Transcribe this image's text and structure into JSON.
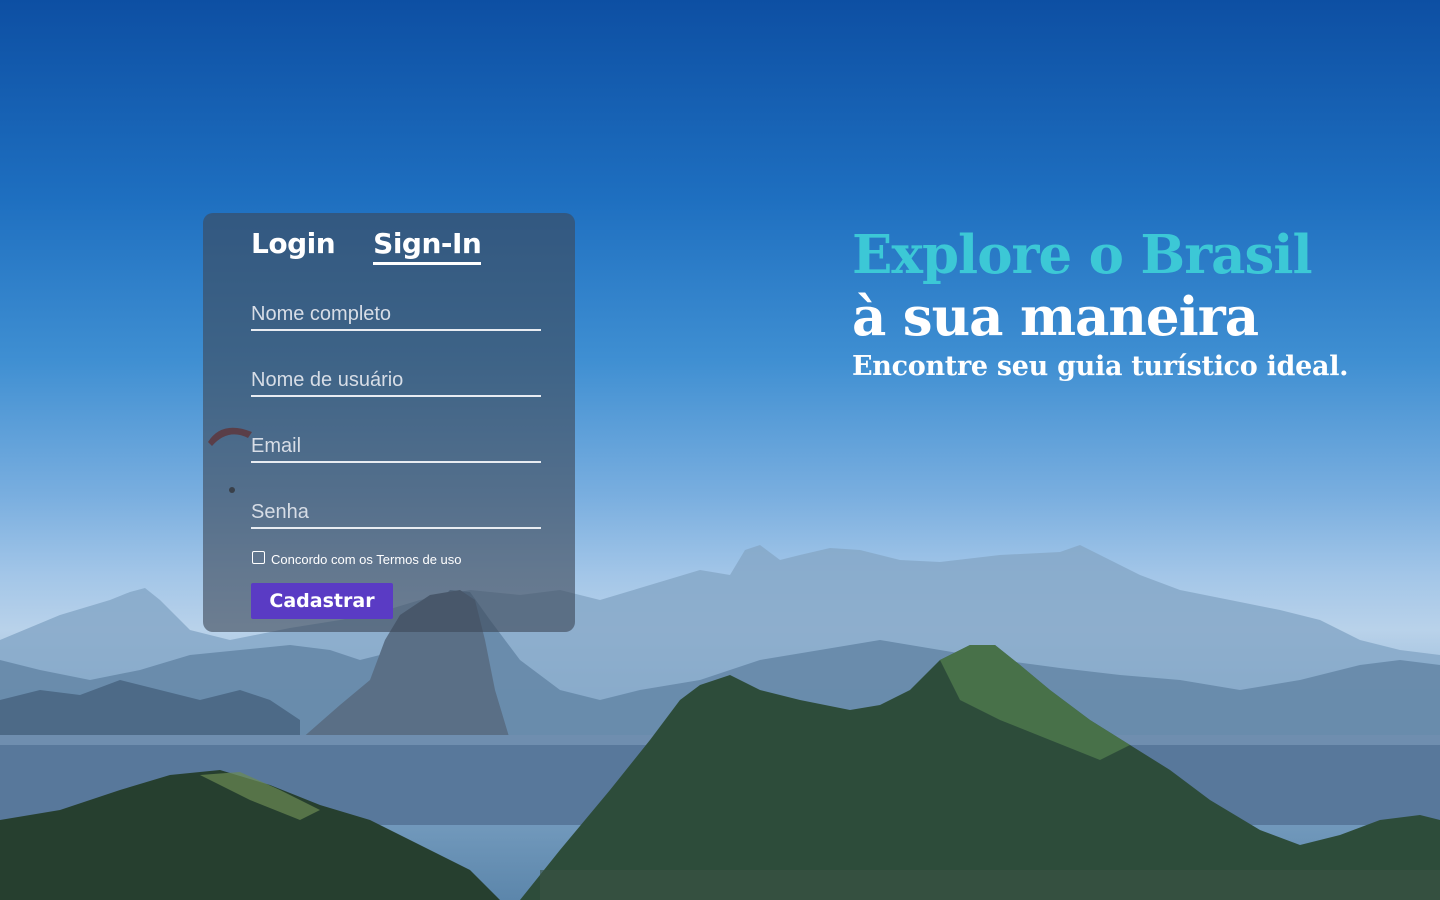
{
  "auth_card": {
    "tabs": [
      {
        "label": "Login",
        "active": false
      },
      {
        "label": "Sign-In",
        "active": true
      }
    ],
    "fields": {
      "full_name": {
        "placeholder": "Nome completo",
        "value": ""
      },
      "username": {
        "placeholder": "Nome de usuário",
        "value": ""
      },
      "email": {
        "placeholder": "Email",
        "value": ""
      },
      "password": {
        "placeholder": "Senha",
        "value": ""
      }
    },
    "terms": {
      "label": "Concordo com os Termos de uso",
      "checked": false
    },
    "submit_label": "Cadastrar"
  },
  "hero": {
    "line1": "Explore o Brasil",
    "line2": "à sua maneira",
    "tagline": "Encontre seu guia turístico ideal."
  },
  "colors": {
    "accent_teal": "#3cc8d6",
    "button_purple": "#5a3bc4",
    "sky_blue": "#1e6fc0"
  },
  "background": {
    "icon": "rio-de-janeiro-landscape-photo"
  }
}
